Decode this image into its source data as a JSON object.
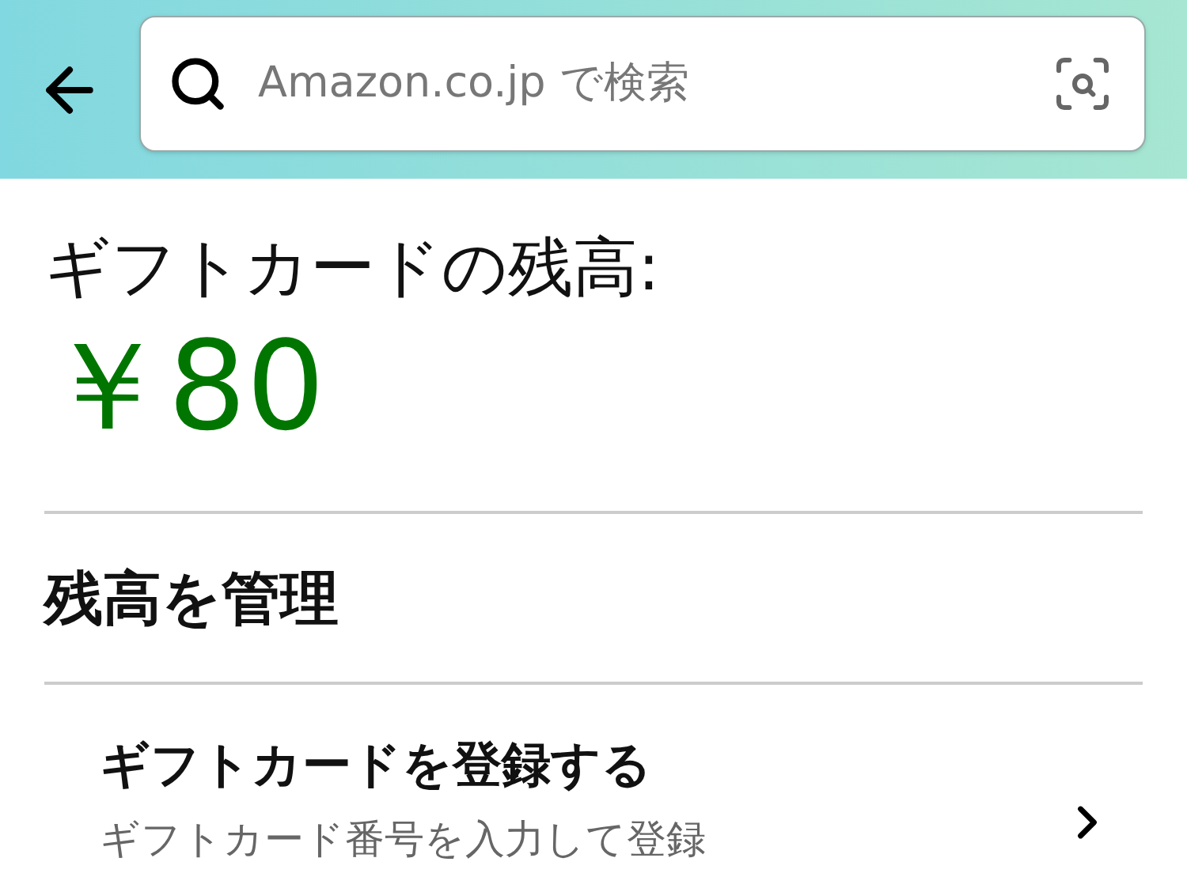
{
  "search": {
    "placeholder": "Amazon.co.jp で検索"
  },
  "balance": {
    "label": "ギフトカードの残高:",
    "amount": "￥80"
  },
  "manage": {
    "heading": "残高を管理",
    "items": [
      {
        "title": "ギフトカードを登録する",
        "subtitle": "ギフトカード番号を入力して登録"
      }
    ]
  }
}
